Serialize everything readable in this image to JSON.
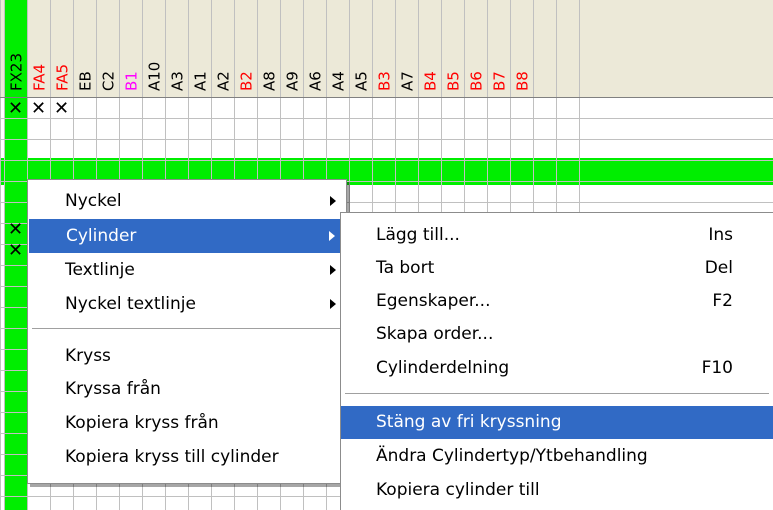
{
  "columns": [
    {
      "label": "FX23",
      "color": "#000000",
      "bg": "#00ee00"
    },
    {
      "label": "FA4",
      "color": "#ff0000"
    },
    {
      "label": "FA5",
      "color": "#ff0000"
    },
    {
      "label": "EB",
      "color": "#000000"
    },
    {
      "label": "C2",
      "color": "#000000"
    },
    {
      "label": "B1",
      "color": "#ff00ff"
    },
    {
      "label": "A10",
      "color": "#000000"
    },
    {
      "label": "A3",
      "color": "#000000"
    },
    {
      "label": "A1",
      "color": "#000000"
    },
    {
      "label": "A2",
      "color": "#000000"
    },
    {
      "label": "B2",
      "color": "#ff0000"
    },
    {
      "label": "A8",
      "color": "#000000"
    },
    {
      "label": "A9",
      "color": "#000000"
    },
    {
      "label": "A6",
      "color": "#000000"
    },
    {
      "label": "A4",
      "color": "#000000"
    },
    {
      "label": "A5",
      "color": "#000000"
    },
    {
      "label": "B3",
      "color": "#ff0000"
    },
    {
      "label": "A7",
      "color": "#000000"
    },
    {
      "label": "B4",
      "color": "#ff0000"
    },
    {
      "label": "B5",
      "color": "#ff0000"
    },
    {
      "label": "B6",
      "color": "#ff0000"
    },
    {
      "label": "B7",
      "color": "#ff0000"
    },
    {
      "label": "B8",
      "color": "#ff0000"
    }
  ],
  "cross_glyph": "✕",
  "row1_crosses": [
    0,
    1,
    2
  ],
  "colors": {
    "green": "#00ee00",
    "highlight": "#316ac5",
    "header_bg": "#ece9d8",
    "grid_line": "#c0c0c0"
  },
  "context_menu": {
    "items": [
      {
        "label": "Nyckel",
        "submenu": true
      },
      {
        "label": "Cylinder",
        "submenu": true,
        "highlighted": true
      },
      {
        "label": "Textlinje",
        "submenu": true
      },
      {
        "label": "Nyckel textlinje",
        "submenu": true
      },
      {
        "separator": true
      },
      {
        "label": "Kryss"
      },
      {
        "label": "Kryssa från"
      },
      {
        "label": "Kopiera kryss från"
      },
      {
        "label": "Kopiera kryss till cylinder"
      }
    ]
  },
  "submenu": {
    "items": [
      {
        "label": "Lägg till...",
        "shortcut": "Ins"
      },
      {
        "label": "Ta bort",
        "shortcut": "Del"
      },
      {
        "label": "Egenskaper...",
        "shortcut": "F2"
      },
      {
        "label": "Skapa order...",
        "shortcut": ""
      },
      {
        "label": "Cylinderdelning",
        "shortcut": "F10"
      },
      {
        "separator": true
      },
      {
        "label": "Stäng av fri kryssning",
        "shortcut": "",
        "highlighted": true
      },
      {
        "label": "Ändra Cylindertyp/Ytbehandling",
        "shortcut": ""
      },
      {
        "label": "Kopiera cylinder till",
        "shortcut": ""
      }
    ]
  }
}
